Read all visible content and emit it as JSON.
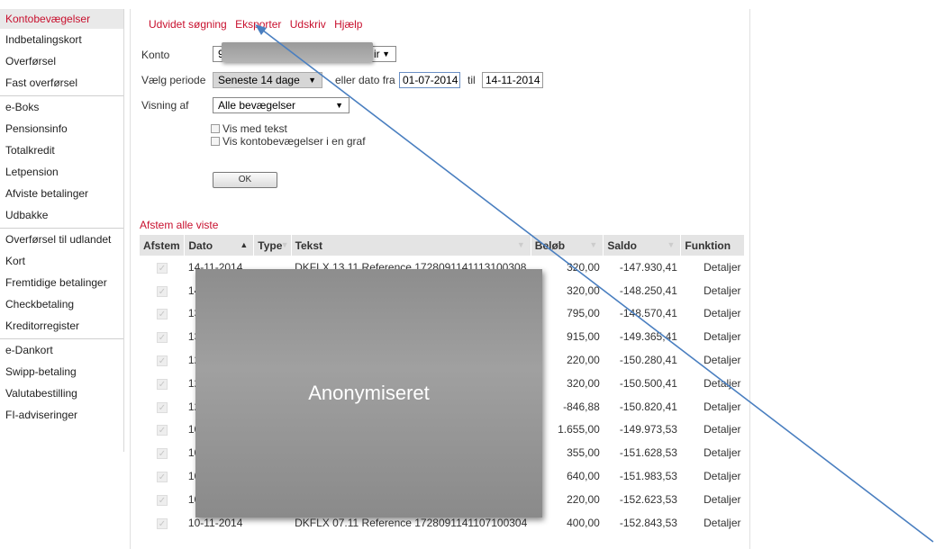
{
  "sidebar": {
    "groups": [
      [
        "Kontobevægelser",
        "Indbetalingskort",
        "Overførsel",
        "Fast overførsel"
      ],
      [
        "e-Boks",
        "Pensionsinfo",
        "Totalkredit",
        "Letpension",
        "Afviste betalinger",
        "Udbakke"
      ],
      [
        "Overførsel til udlandet",
        "Kort",
        "Fremtidige betalinger",
        "Checkbetaling",
        "Kreditorregister"
      ],
      [
        "e-Dankort",
        "Swipp-betaling",
        "Valutabestilling",
        "FI-adviseringer"
      ]
    ]
  },
  "topnav": [
    "Udvidet søgning",
    "Eksporter",
    "Udskriv",
    "Hjælp"
  ],
  "form": {
    "konto_label": "Konto",
    "konto_prefix": "96",
    "konto_suffix": "ir",
    "periode_label": "Vælg periode",
    "periode_value": "Seneste 14 dage",
    "dato_fra_label": "eller dato fra",
    "dato_fra": "01-07-2014",
    "til_label": "til",
    "dato_til": "14-11-2014",
    "visning_label": "Visning af",
    "visning_value": "Alle bevægelser",
    "vis_tekst": "Vis med tekst",
    "vis_graf": "Vis kontobevægelser i en graf",
    "ok": "OK"
  },
  "afstem_link": "Afstem alle viste",
  "table": {
    "headers": [
      "Afstem",
      "Dato",
      "Type",
      "Tekst",
      "Beløb",
      "Saldo",
      "Funktion"
    ],
    "rows": [
      {
        "dato": "14-11-2014",
        "tekst": "DKFLX 13.11 Reference 1728091141113100308",
        "belob": "320,00",
        "saldo": "-147.930,41",
        "funk": "Detaljer"
      },
      {
        "dato": "14",
        "tekst": "",
        "belob": "320,00",
        "saldo": "-148.250,41",
        "funk": "Detaljer"
      },
      {
        "dato": "13",
        "tekst": "",
        "belob": "795,00",
        "saldo": "-148.570,41",
        "funk": "Detaljer"
      },
      {
        "dato": "13",
        "tekst": "",
        "belob": "915,00",
        "saldo": "-149.365,41",
        "funk": "Detaljer"
      },
      {
        "dato": "12",
        "tekst": "",
        "belob": "220,00",
        "saldo": "-150.280,41",
        "funk": "Detaljer"
      },
      {
        "dato": "12",
        "tekst": "",
        "belob": "320,00",
        "saldo": "-150.500,41",
        "funk": "Detaljer"
      },
      {
        "dato": "12",
        "tekst": "",
        "belob": "-846,88",
        "saldo": "-150.820,41",
        "funk": "Detaljer"
      },
      {
        "dato": "10",
        "tekst": "",
        "belob": "1.655,00",
        "saldo": "-149.973,53",
        "funk": "Detaljer"
      },
      {
        "dato": "10",
        "tekst": "",
        "belob": "355,00",
        "saldo": "-151.628,53",
        "funk": "Detaljer"
      },
      {
        "dato": "10",
        "tekst": "",
        "belob": "640,00",
        "saldo": "-151.983,53",
        "funk": "Detaljer"
      },
      {
        "dato": "10",
        "tekst": "",
        "belob": "220,00",
        "saldo": "-152.623,53",
        "funk": "Detaljer"
      },
      {
        "dato": "10-11-2014",
        "tekst": "DKFLX 07.11 Reference 1728091141107100304",
        "belob": "400,00",
        "saldo": "-152.843,53",
        "funk": "Detaljer"
      }
    ]
  },
  "overlay_text": "Anonymiseret",
  "colors": {
    "accent": "#c8102e",
    "negative": "#d93434",
    "arrow": "#4a7fc0"
  }
}
